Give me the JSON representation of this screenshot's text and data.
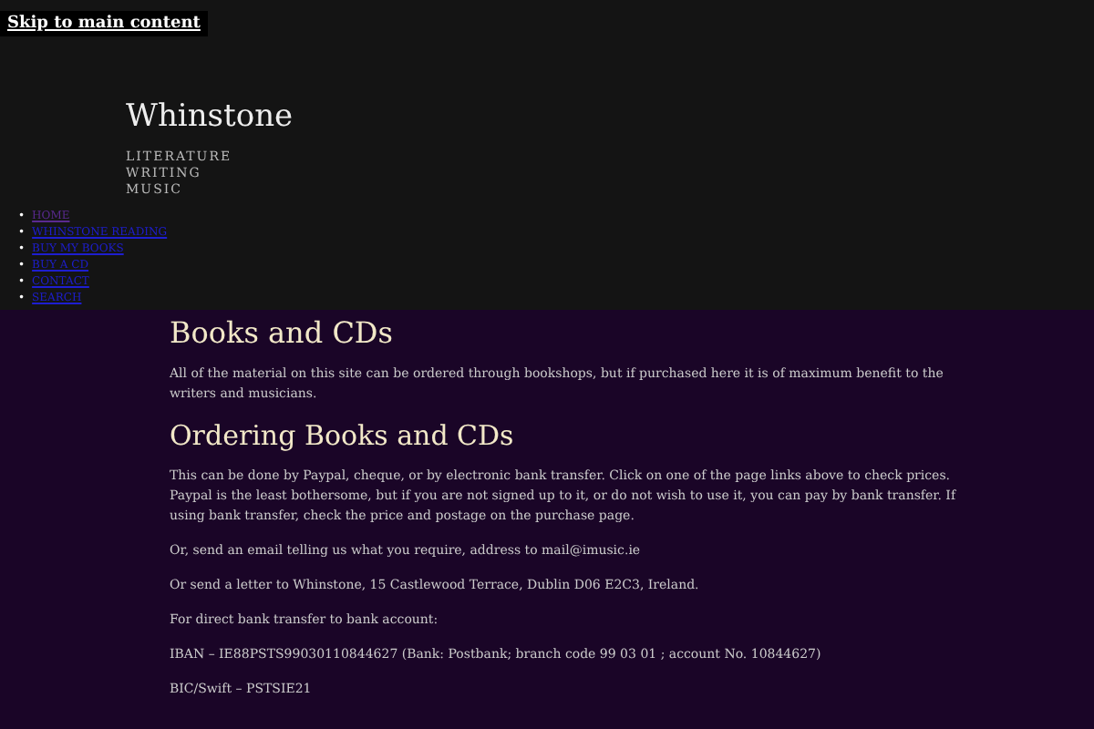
{
  "skip_link": "Skip to main content",
  "site": {
    "title": "Whinstone",
    "tagline": [
      "LITERATURE",
      "WRITING",
      "MUSIC"
    ]
  },
  "nav": [
    {
      "bullet": "•",
      "label": "HOME",
      "selected": true
    },
    {
      "bullet": "•",
      "label": "WHINSTONE READING",
      "selected": false
    },
    {
      "bullet": "•",
      "label": "BUY MY BOOKS",
      "selected": false
    },
    {
      "bullet": "•",
      "label": "BUY A CD",
      "selected": false
    },
    {
      "bullet": "•",
      "label": "CONTACT",
      "selected": false
    },
    {
      "bullet": "•",
      "label": "SEARCH",
      "selected": false
    }
  ],
  "content": [
    {
      "kind": "heading",
      "text": "Books and CDs"
    },
    {
      "kind": "paragraph",
      "text": "All of the material on this site can be ordered through bookshops, but if purchased here it is of maximum benefit to the writers and musicians."
    },
    {
      "kind": "heading",
      "text": "Ordering Books and CDs"
    },
    {
      "kind": "paragraph",
      "text": "This can be done by Paypal, cheque, or by electronic bank transfer. Click on one of the page links above to check prices. Paypal is the least bothersome, but if you are not signed up to it, or do not wish to use it, you can pay by bank transfer. If using bank transfer, check the price and postage on the purchase page."
    },
    {
      "kind": "paragraph",
      "text": "Or, send an email telling us what you require, address to mail@imusic.ie"
    },
    {
      "kind": "paragraph",
      "text": "Or send a letter to Whinstone, 15 Castlewood Terrace, Dublin D06 E2C3, Ireland."
    },
    {
      "kind": "paragraph",
      "text": "For direct bank transfer to bank account:"
    },
    {
      "kind": "paragraph",
      "text": "IBAN – IE88PSTS99030110844627 (Bank: Postbank; branch code 99 03 01 ; account No. 10844627)"
    },
    {
      "kind": "paragraph",
      "text": "BIC/Swift – PSTSIE21"
    }
  ]
}
